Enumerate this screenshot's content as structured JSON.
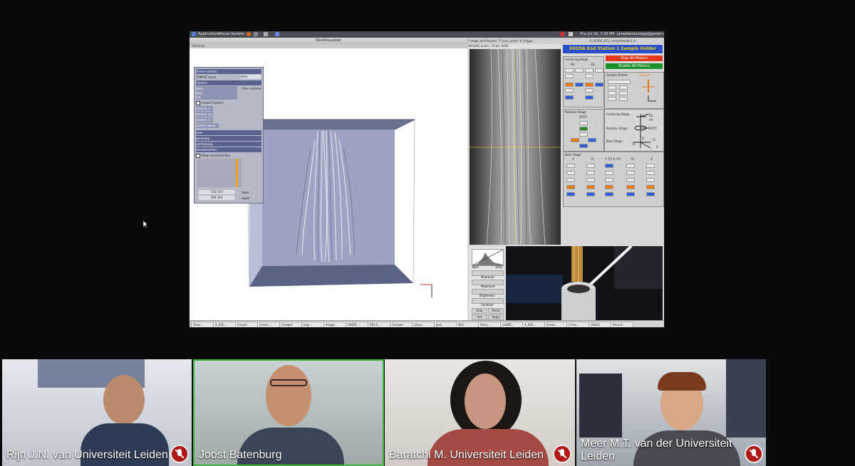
{
  "desktop": {
    "menu": [
      "Applications",
      "Places",
      "System"
    ],
    "clock": "Thu Jul 16,  7:35 PM",
    "user": "janwillemburlage@gmail.com"
  },
  "slicevisualizer": {
    "title": "SliceVisualizer",
    "menu_label": "Windows",
    "panel": {
      "scene_controls": "Scene controls",
      "tomviz_group": "TOMVIZ recon",
      "tomviz_value": "name",
      "camera": "Camera",
      "list": [
        "bone",
        "gray",
        "hot"
      ],
      "color_scheme": "Color scheme",
      "instant_camera": "Instant Camera",
      "camera_items": [
        "camera -x",
        "camera +z",
        "camera -z",
        "camera persp"
      ],
      "axes": "axes",
      "geometry": "geometry",
      "partitioning": "partitioning",
      "reconstruction": "reconstruction",
      "show_reconstruction": "Show reconstruction",
      "lower_value": "-132.502",
      "lower_label": "lower",
      "upper_value": "366.344",
      "upper_label": "upper"
    }
  },
  "image_viewer": {
    "title": "(\"image_atsVisaalue\":{\"scan_index\":0,\"trigge",
    "info": "384x860 pixels; 16-bit; 830K",
    "bc": {
      "min": "1821",
      "max": "3301",
      "minimum": "Minimum",
      "maximum": "Maximum",
      "brightness": "Brightness",
      "contrast": "Contrast",
      "auto": "Auto",
      "reset": "Reset",
      "set": "Set",
      "apply": "Apply"
    }
  },
  "epics": {
    "window_title": "X_X02DA_ES1_sampleHolder1.ui",
    "title": "X02DA End Station 1 Sample Holder",
    "stop_all": "Stop All Motors",
    "enable_all": "Enable All Motors",
    "centering_stage": "Centering Stage",
    "xx": "XX",
    "zz": "ZZ",
    "sample_details": "Sample Details",
    "sample": "Sample",
    "rotation_stage": "Rotation Stage",
    "roty": "ROTY",
    "labels_diagram": [
      "Centering Stage",
      "Rotation Stage",
      "Base Stage"
    ],
    "base_stage": "Base Stage",
    "base_axes": [
      "X",
      "Y1",
      "Y (Y1 & Y2)",
      "Y2",
      "Z"
    ],
    "axis_letters": [
      "ZZ",
      "XX",
      "ROTY",
      "Y1",
      "Y2",
      "X",
      "Z"
    ]
  },
  "taskbar": {
    "items": [
      "[Saur...",
      "X_X02...",
      "[recod...",
      "[recon...",
      "[image]",
      "Log...",
      "Image...",
      "[X02D...",
      "[IR] G...",
      "Console",
      "[Zero...",
      "Java",
      "BGC",
      "Story...",
      "caQtD...",
      "X_X02...",
      "[recor...",
      "(\"ima...",
      "[disk3...",
      "Shrunt..."
    ]
  },
  "participants": [
    {
      "name": "Rijn J.N. van Universiteit Leiden",
      "muted": true
    },
    {
      "name": "Joost Batenburg",
      "muted": false
    },
    {
      "name": "Baratchi M. Universiteit Leiden",
      "muted": true
    },
    {
      "name": "Meer M.T. van der Universiteit\nLeiden",
      "muted": true
    }
  ],
  "colors": {
    "speaker_border": "#3db83d",
    "mute_badge": "#b01818",
    "epics_title_bg": "#2b4fc9",
    "epics_title_fg": "#f0d21a",
    "stop_bg": "#e13a1a",
    "enable_bg": "#1f8f2c"
  }
}
